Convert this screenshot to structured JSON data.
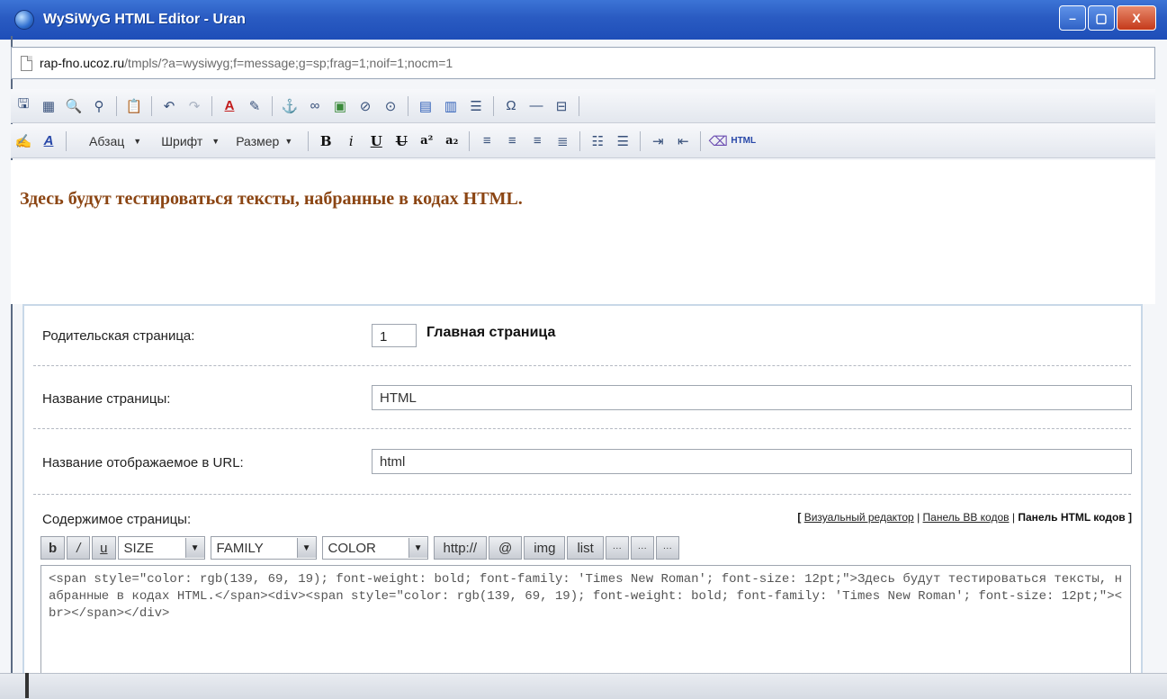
{
  "window": {
    "title": "WySiWyG HTML Editor - Uran",
    "buttons": {
      "minimize": "–",
      "maximize": "▢",
      "close": "X"
    }
  },
  "url": {
    "host": "rap-fno.ucoz.ru",
    "path": "/tmpls/?a=wysiwyg;f=message;g=sp;frag=1;noif=1;nocm=1"
  },
  "toolbar2": {
    "paragraph": "Абзац",
    "font": "Шрифт",
    "size": "Размер",
    "bold": "B",
    "italic": "i",
    "underline": "U",
    "strike": "U",
    "superscript": "a²",
    "subscript": "a₂",
    "html": "HTML"
  },
  "editor": {
    "text": "Здесь будут тестироваться тексты, набранные в кодах HTML.",
    "text_color": "#8b4513"
  },
  "form": {
    "parent_label": "Родительская страница:",
    "parent_id": "1",
    "parent_name": "Главная страница",
    "page_name_label": "Название страницы:",
    "page_name_value": "HTML",
    "url_name_label": "Название отображаемое в URL:",
    "url_name_value": "html",
    "content_label": "Содержимое страницы:",
    "modes": {
      "visual": "Визуальный редактор",
      "bb": "Панель BB кодов",
      "html": "Панель HTML кодов"
    }
  },
  "bbcodes": {
    "bold": "b",
    "italic": "/",
    "underline": "u",
    "size": "SIZE",
    "family": "FAMILY",
    "color": "COLOR",
    "http": "http://",
    "email": "@",
    "img": "img",
    "list": "list",
    "more1": "···",
    "more2": "···",
    "more3": "···"
  },
  "code": "<span style=\"color: rgb(139, 69, 19); font-weight: bold; font-family: 'Times New Roman'; font-size: 12pt;\">Здесь будут тестироваться тексты, набранные в кодах HTML.</span><div><span style=\"color: rgb(139, 69, 19); font-weight: bold; font-family: 'Times New Roman'; font-size: 12pt;\"><br></span></div>"
}
